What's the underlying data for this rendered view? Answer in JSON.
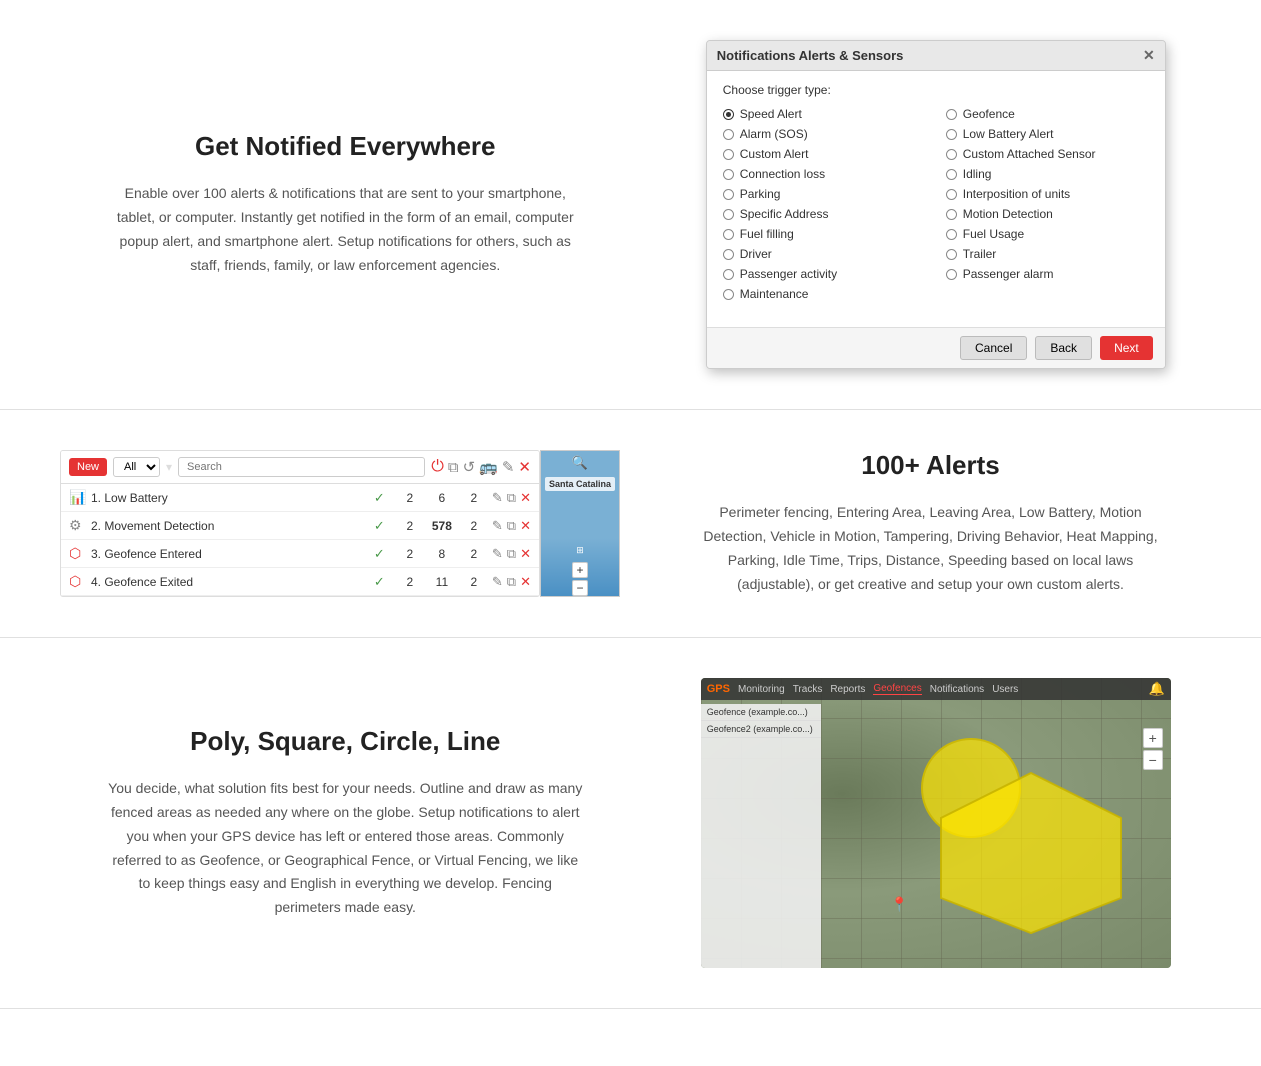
{
  "section1": {
    "title": "Get Notified Everywhere",
    "description": "Enable over 100 alerts & notifications that are sent to your smartphone, tablet, or computer. Instantly get notified in the form of an email, computer popup alert, and smartphone alert. Setup notifications for others, such as staff, friends, family, or law enforcement agencies.",
    "dialog": {
      "title": "Notifications Alerts & Sensors",
      "trigger_label": "Choose trigger type:",
      "options_left": [
        "Speed Alert",
        "Alarm (SOS)",
        "Custom Alert",
        "Connection loss",
        "Parking",
        "Specific Address",
        "Fuel filling",
        "Driver",
        "Passenger activity",
        "Maintenance"
      ],
      "options_right": [
        "Geofence",
        "Low Battery Alert",
        "Custom Attached Sensor",
        "Idling",
        "Interposition of units",
        "Motion Detection",
        "Fuel Usage",
        "Trailer",
        "Passenger alarm"
      ],
      "selected": "Speed Alert",
      "cancel_label": "Cancel",
      "back_label": "Back",
      "next_label": "Next"
    }
  },
  "section2": {
    "title": "100+ Alerts",
    "description": "Perimeter fencing, Entering Area, Leaving Area, Low Battery, Motion Detection, Vehicle in Motion, Tampering, Driving Behavior, Heat Mapping, Parking, Idle Time, Trips, Distance, Speeding based on local laws (adjustable), or get creative and setup your own custom alerts.",
    "alerts": {
      "new_label": "New",
      "filter_all": "All",
      "search_placeholder": "Search",
      "rows": [
        {
          "icon": "chart",
          "name": "1. Low Battery",
          "active": true,
          "count1": 2,
          "count2": 6,
          "count3": 2
        },
        {
          "icon": "sensor",
          "name": "2. Movement Detection",
          "active": true,
          "count1": 2,
          "count2": 578,
          "count3": 2
        },
        {
          "icon": "fence",
          "name": "3. Geofence Entered",
          "active": true,
          "count1": 2,
          "count2": 8,
          "count3": 2
        },
        {
          "icon": "fence-exit",
          "name": "4. Geofence Exited",
          "active": true,
          "count1": 2,
          "count2": 11,
          "count3": 2
        }
      ]
    }
  },
  "section3": {
    "title": "Poly, Square, Circle, Line",
    "description": "You decide, what solution fits best for your needs. Outline and draw as many fenced areas as needed any where on the globe. Setup notifications to alert you when your GPS device has left or entered those areas. Commonly referred to as Geofence, or Geographical Fence, or Virtual Fencing, we like to keep things easy and English in everything we develop. Fencing perimeters made easy.",
    "geo_sidebar_items": [
      "Geofence (example.co...)",
      "Geofence2 (example.co...)"
    ],
    "toolbar_items": [
      "Monitoring",
      "Tracks",
      "Reports",
      "Geofences",
      "Notifications",
      "Users"
    ]
  },
  "icons": {
    "close": "✕",
    "search": "🔍",
    "refresh": "↺",
    "bus": "🚌",
    "copy": "⧉",
    "delete": "✕",
    "check": "✓",
    "plus": "+",
    "minus": "−",
    "layers": "⊞",
    "power": "⏻",
    "edit": "✎"
  }
}
